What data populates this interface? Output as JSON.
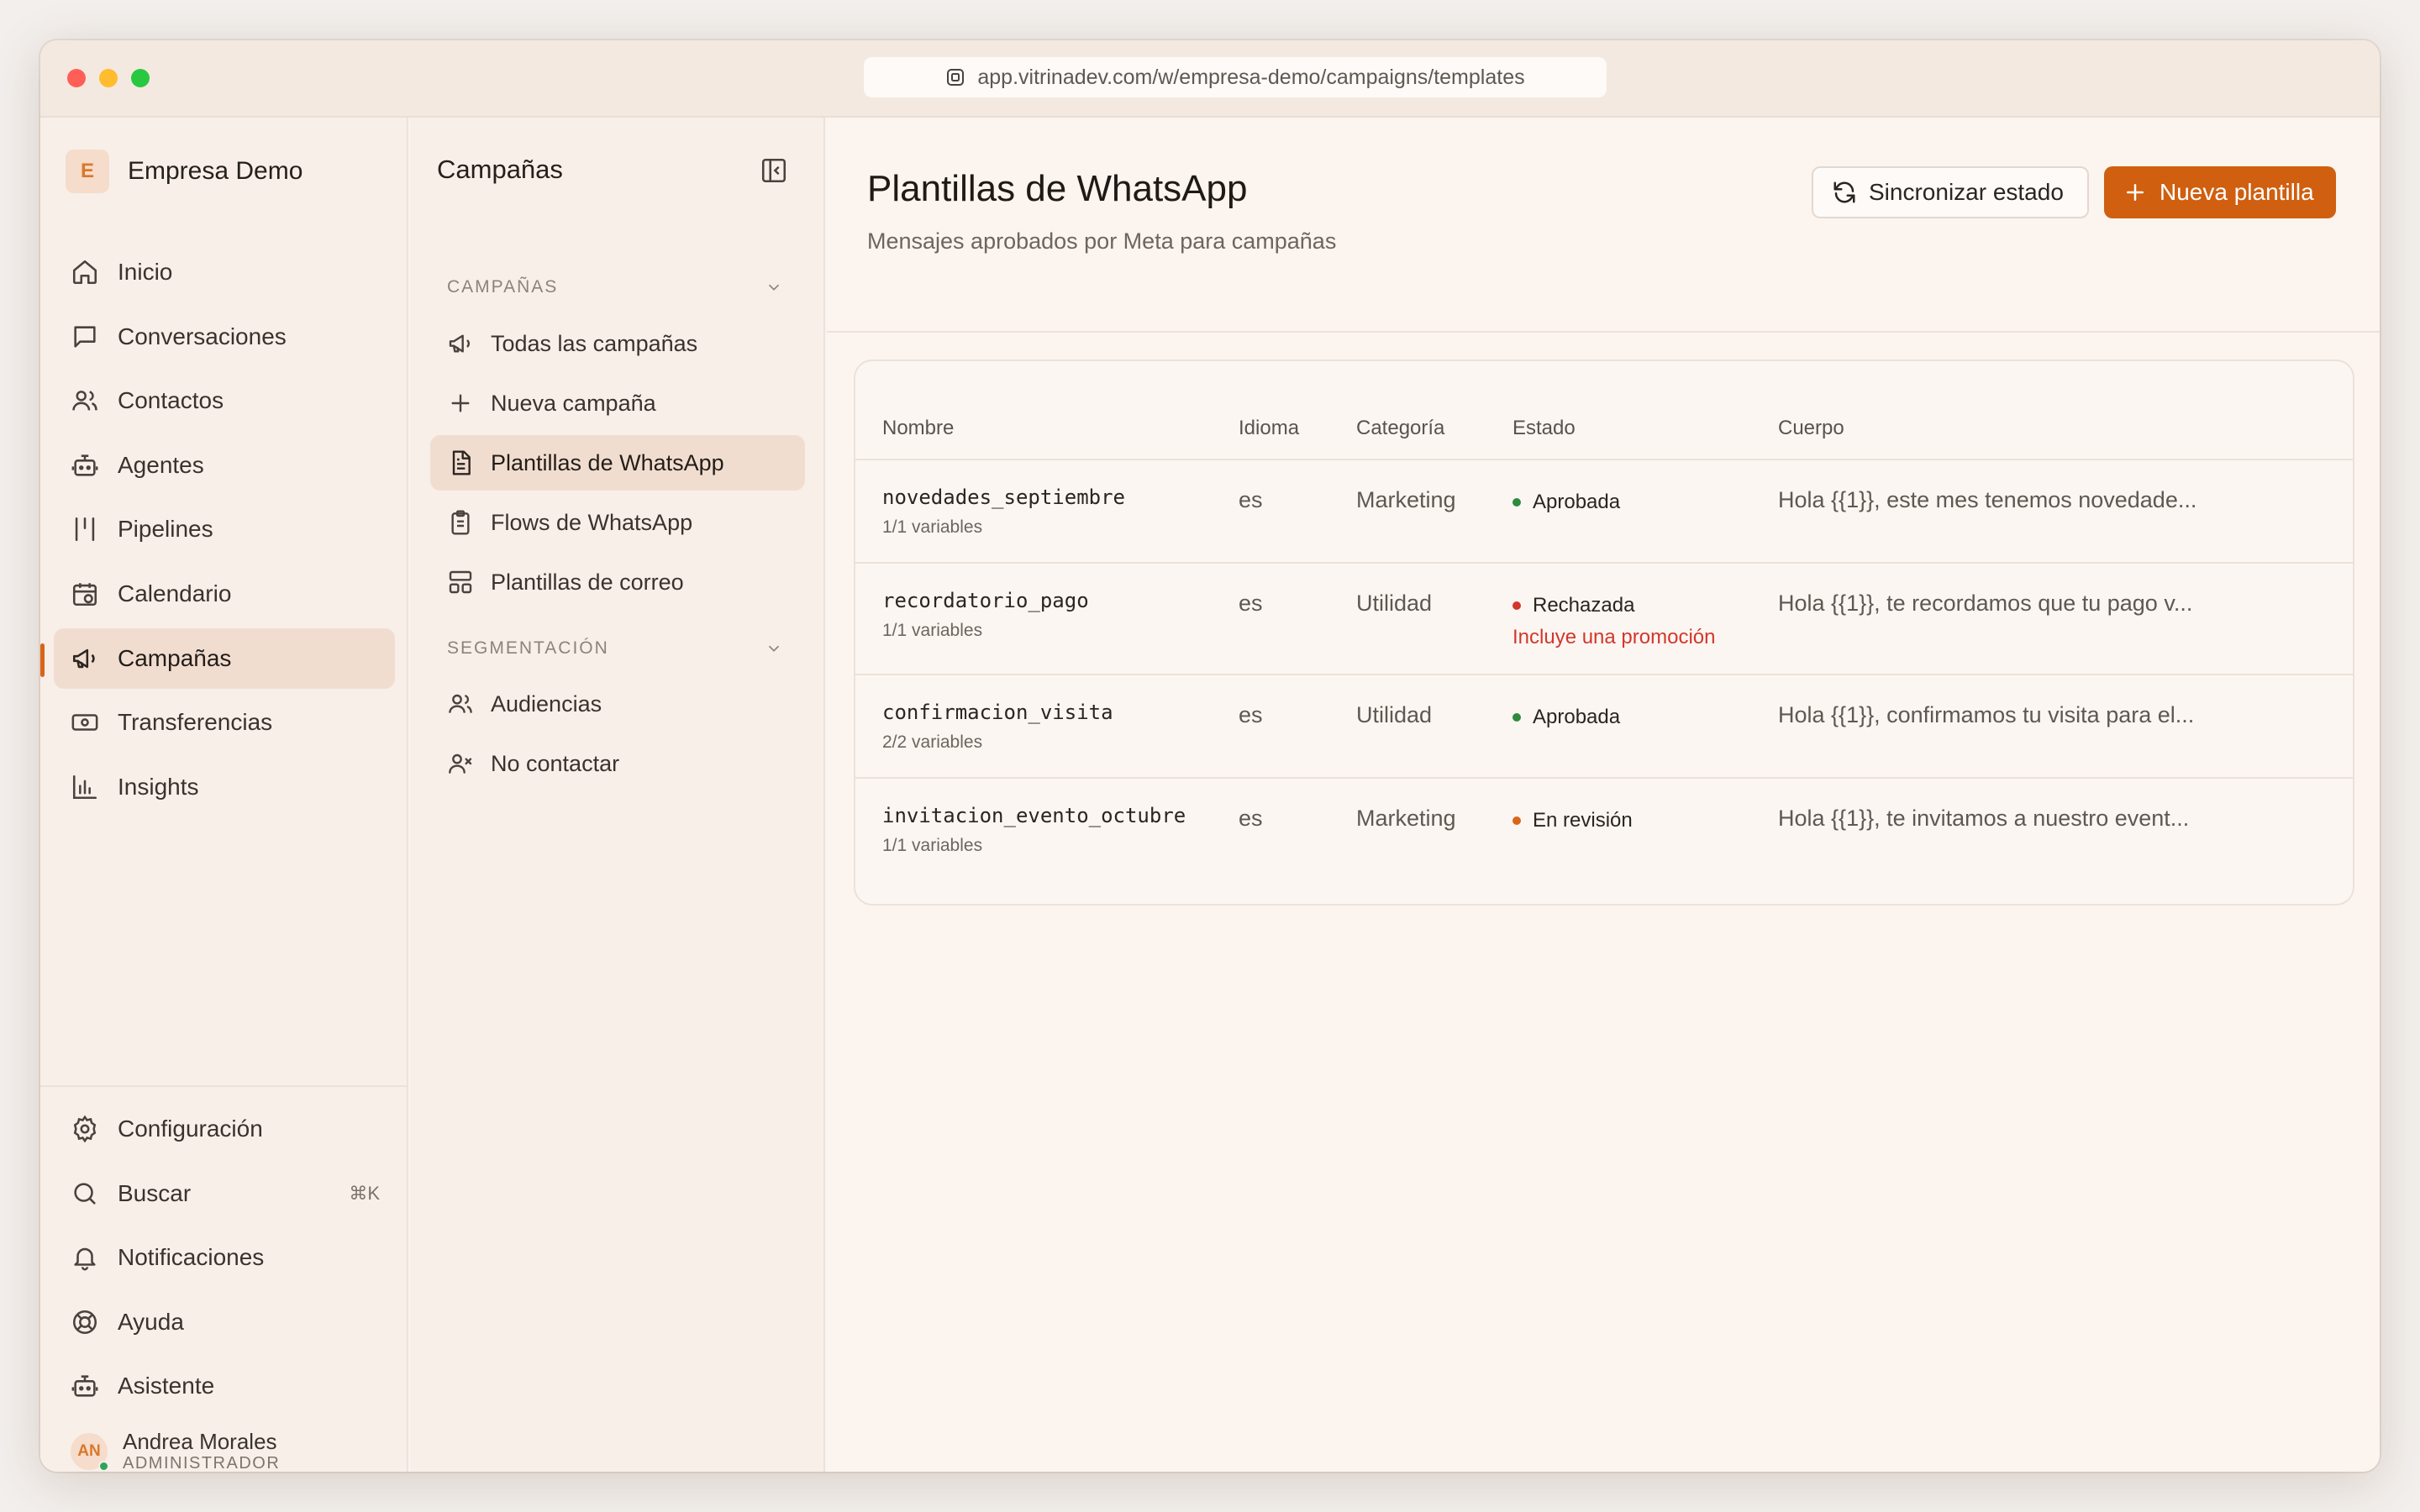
{
  "browser": {
    "url": "app.vitrinadev.com/w/empresa-demo/campaigns/templates"
  },
  "org": {
    "initial": "E",
    "name": "Empresa Demo"
  },
  "nav": [
    {
      "label": "Inicio",
      "icon": "home-icon"
    },
    {
      "label": "Conversaciones",
      "icon": "chat-icon"
    },
    {
      "label": "Contactos",
      "icon": "users-icon"
    },
    {
      "label": "Agentes",
      "icon": "bot-icon"
    },
    {
      "label": "Pipelines",
      "icon": "pipeline-icon"
    },
    {
      "label": "Calendario",
      "icon": "calendar-icon"
    },
    {
      "label": "Campañas",
      "icon": "megaphone-icon",
      "active": true
    },
    {
      "label": "Transferencias",
      "icon": "banknote-icon"
    },
    {
      "label": "Insights",
      "icon": "chart-icon"
    }
  ],
  "nav_bottom": [
    {
      "label": "Configuración",
      "icon": "gear-icon"
    },
    {
      "label": "Buscar",
      "icon": "search-icon",
      "shortcut": "⌘K"
    },
    {
      "label": "Notificaciones",
      "icon": "bell-icon"
    },
    {
      "label": "Ayuda",
      "icon": "lifebuoy-icon"
    },
    {
      "label": "Asistente",
      "icon": "bot-icon"
    }
  ],
  "user": {
    "initials": "AN",
    "name": "Andrea Morales",
    "role": "ADMINISTRADOR"
  },
  "panel": {
    "title": "Campañas",
    "sections": [
      {
        "label": "CAMPAÑAS",
        "items": [
          {
            "label": "Todas las campañas",
            "icon": "megaphone-icon"
          },
          {
            "label": "Nueva campaña",
            "icon": "plus-icon"
          },
          {
            "label": "Plantillas de WhatsApp",
            "icon": "file-text-icon",
            "active": true
          },
          {
            "label": "Flows de WhatsApp",
            "icon": "clipboard-icon"
          },
          {
            "label": "Plantillas de correo",
            "icon": "layout-icon"
          }
        ]
      },
      {
        "label": "SEGMENTACIÓN",
        "items": [
          {
            "label": "Audiencias",
            "icon": "users-icon"
          },
          {
            "label": "No contactar",
            "icon": "user-x-icon"
          }
        ]
      }
    ]
  },
  "main": {
    "title": "Plantillas de WhatsApp",
    "subtitle": "Mensajes aprobados por Meta para campañas",
    "sync_label": "Sincronizar estado",
    "new_label": "Nueva plantilla",
    "columns": [
      "Nombre",
      "Idioma",
      "Categoría",
      "Estado",
      "Cuerpo"
    ],
    "rows": [
      {
        "name": "novedades_septiembre",
        "vars": "1/1 variables",
        "lang": "es",
        "category": "Marketing",
        "status": "Aprobada",
        "status_color": "#2e8b3e",
        "reason": "",
        "body": "Hola {{1}}, este mes tenemos novedade..."
      },
      {
        "name": "recordatorio_pago",
        "vars": "1/1 variables",
        "lang": "es",
        "category": "Utilidad",
        "status": "Rechazada",
        "status_color": "#d2372c",
        "reason": "Incluye una promoción",
        "body": "Hola {{1}}, te recordamos que tu pago v..."
      },
      {
        "name": "confirmacion_visita",
        "vars": "2/2 variables",
        "lang": "es",
        "category": "Utilidad",
        "status": "Aprobada",
        "status_color": "#2e8b3e",
        "reason": "",
        "body": "Hola {{1}}, confirmamos tu visita para el..."
      },
      {
        "name": "invitacion_evento_octubre",
        "vars": "1/1 variables",
        "lang": "es",
        "category": "Marketing",
        "status": "En revisión",
        "status_color": "#d9651a",
        "reason": "",
        "body": "Hola {{1}}, te invitamos a nuestro event..."
      }
    ]
  },
  "colors": {
    "accent": "#d05f10",
    "approved": "#2e8b3e",
    "rejected": "#d2372c",
    "review": "#d9651a"
  }
}
